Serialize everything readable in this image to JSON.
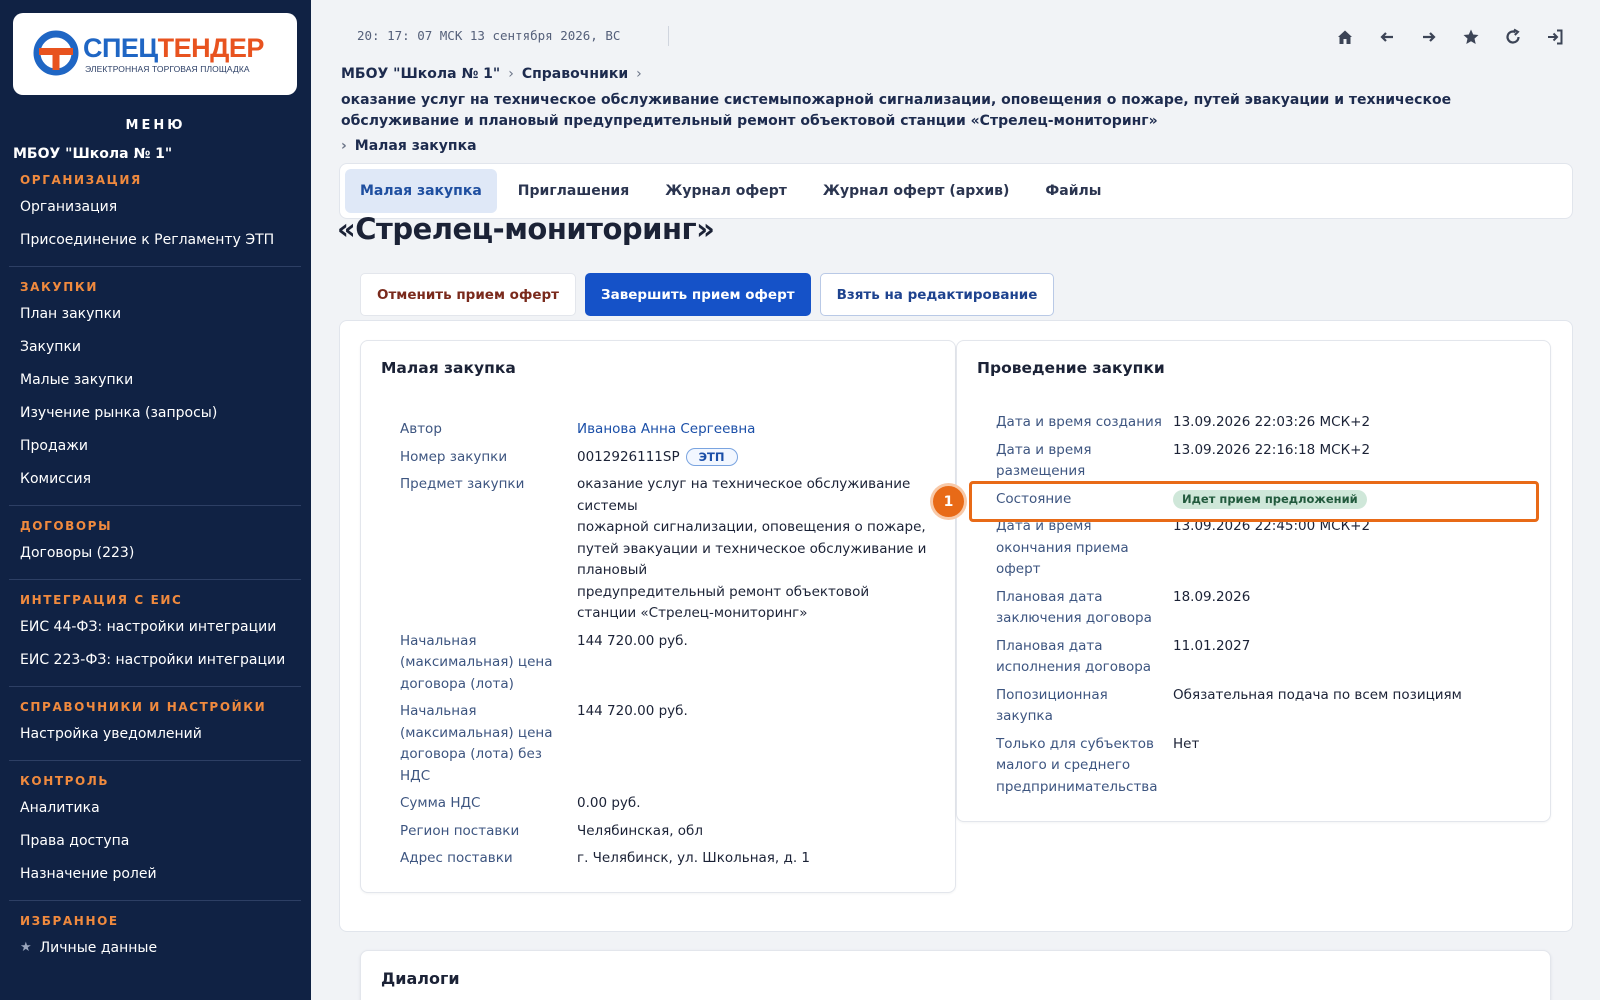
{
  "logo": {
    "word_a": "СПЕЦ",
    "word_b": "ТЕНДЕР",
    "subtitle": "ЭЛЕКТРОННАЯ ТОРГОВАЯ ПЛОЩАДКА",
    "colors": {
      "blue": "#1f66c4",
      "orange": "#e8531f"
    }
  },
  "sidebar": {
    "menu_title": "МЕНЮ",
    "org_name": "МБОУ \"Школа № 1\"",
    "sections": [
      {
        "header": "ОРГАНИЗАЦИЯ",
        "items": [
          "Организация",
          "Присоединение к Регламенту ЭТП"
        ]
      },
      {
        "header": "ЗАКУПКИ",
        "items": [
          "План закупки",
          "Закупки",
          "Малые закупки",
          "Изучение рынка (запросы)",
          "Продажи",
          "Комиссия"
        ]
      },
      {
        "header": "ДОГОВОРЫ",
        "items": [
          "Договоры (223)"
        ]
      },
      {
        "header": "ИНТЕГРАЦИЯ С ЕИС",
        "items": [
          "ЕИС 44-ФЗ: настройки интеграции",
          "ЕИС 223-ФЗ: настройки интеграции"
        ]
      },
      {
        "header": "СПРАВОЧНИКИ И НАСТРОЙКИ",
        "items": [
          "Настройка уведомлений"
        ]
      },
      {
        "header": "КОНТРОЛЬ",
        "items": [
          "Аналитика",
          "Права доступа",
          "Назначение ролей"
        ]
      },
      {
        "header": "ИЗБРАННОЕ",
        "items": [
          "Личные данные"
        ]
      }
    ]
  },
  "header": {
    "clock": "20: 17: 07 МСК  13 сентября 2026, ВС",
    "toolbar_icons": [
      "home-icon",
      "arrow-left-icon",
      "arrow-right-icon",
      "star-icon",
      "refresh-icon",
      "logout-icon"
    ]
  },
  "breadcrumbs": {
    "first": "МБОУ \"Школа № 1\"",
    "second": "Справочники",
    "long": "оказание услуг на техническое обслуживание системыпожарной сигнализации, оповещения о пожаре, путей эвакуации и техническое обслуживание и плановый предупредительный ремонт объектовой станции «Стрелец-мониторинг»",
    "last": "Малая закупка",
    "sep": "›"
  },
  "tabs": [
    "Малая закупка",
    "Приглашения",
    "Журнал оферт",
    "Журнал оферт (архив)",
    "Файлы"
  ],
  "page_title": "«Стрелец-мониторинг»",
  "actions": {
    "cancel": "Отменить прием оферт",
    "finish": "Завершить прием оферт",
    "edit": "Взять на редактирование"
  },
  "left_panel": {
    "title": "Малая закупка",
    "rows": [
      {
        "label": "Автор",
        "value": "Иванова Анна Сергеевна"
      },
      {
        "label": "Номер закупки",
        "value": "0012926111SP",
        "badge": "ЭТП"
      },
      {
        "label": "Предмет закупки",
        "value_lines": [
          "оказание услуг на техническое обслуживание системы",
          "пожарной сигнализации, оповещения о пожаре, путей эвакуации и техническое обслуживание и плановый",
          "предупредительный ремонт объектовой станции «Стрелец-мониторинг»"
        ]
      },
      {
        "label": "Начальная (максимальная) цена договора (лота)",
        "value": "144 720.00 руб."
      },
      {
        "label": "Начальная (максимальная) цена договора (лота) без НДС",
        "value": "144 720.00 руб."
      },
      {
        "label": "Сумма НДС",
        "value": "0.00 руб."
      },
      {
        "label": "Регион поставки",
        "value": "Челябинская, обл"
      },
      {
        "label": "Адрес поставки",
        "value": "г. Челябинск, ул. Школьная, д. 1"
      }
    ]
  },
  "right_panel": {
    "title": "Проведение закупки",
    "rows": [
      {
        "label": "Дата и время создания",
        "value": "13.09.2026 22:03:26 МСК+2"
      },
      {
        "label": "Дата и время размещения",
        "value": "13.09.2026 22:16:18 МСК+2"
      },
      {
        "label": "Состояние",
        "value": "Идет прием предложений"
      },
      {
        "label": "Дата и время окончания приема оферт",
        "value": "13.09.2026 22:45:00 МСК+2"
      },
      {
        "label": "Плановая дата заключения договора",
        "value": "18.09.2026"
      },
      {
        "label": "Плановая дата исполнения договора",
        "value": "11.01.2027"
      },
      {
        "label": "Попозиционная закупка",
        "value": "Обязательная подача по всем позициям"
      },
      {
        "label": "Только для субъектов малого и среднего предпринимательства",
        "value": "Нет"
      }
    ]
  },
  "callout": {
    "number": "1",
    "color": "#e86a17"
  },
  "dialogs": {
    "title": "Диалоги"
  }
}
